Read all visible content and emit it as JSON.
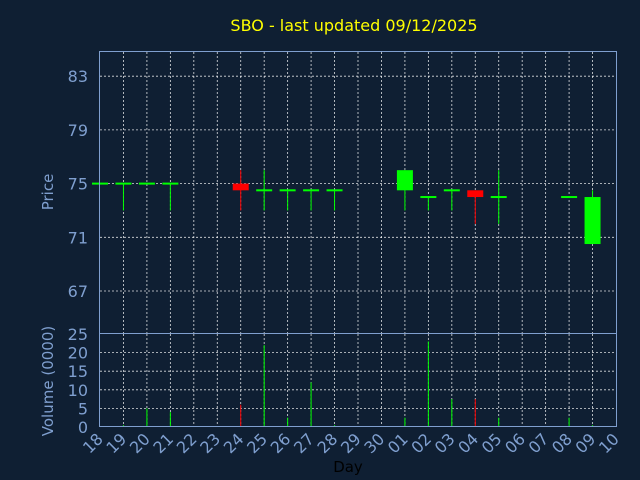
{
  "title": "SBO - last updated 09/12/2025",
  "colors": {
    "background": "#0f1f33",
    "up": "#00ff00",
    "down": "#ff0000",
    "text": "#7f9fcf",
    "title": "#ffff00"
  },
  "chart_data": {
    "type": "candlestick",
    "title": "SBO - last updated 09/12/2025",
    "xlabel": "Day",
    "price_panel": {
      "ylabel": "Price",
      "ylim": [
        63.8,
        84.8
      ],
      "yticks": [
        67,
        71,
        75,
        79,
        83
      ],
      "grid": true
    },
    "volume_panel": {
      "ylabel": "Volume (0000)",
      "ylim": [
        0,
        25
      ],
      "yticks": [
        0,
        5,
        10,
        15,
        20,
        25
      ],
      "grid": true
    },
    "x_ticks": [
      "18",
      "19",
      "20",
      "21",
      "22",
      "23",
      "24",
      "25",
      "26",
      "27",
      "28",
      "29",
      "30",
      "01",
      "02",
      "03",
      "04",
      "05",
      "06",
      "07",
      "08",
      "09",
      "10"
    ],
    "candles": [
      {
        "x": "18",
        "open": 75.0,
        "high": 75.0,
        "low": 75.0,
        "close": 75.0,
        "volume": 0.2
      },
      {
        "x": "19",
        "open": 75.0,
        "high": 75.0,
        "low": 73.0,
        "close": 75.0,
        "volume": 0.5
      },
      {
        "x": "20",
        "open": 75.0,
        "high": 75.0,
        "low": 75.0,
        "close": 75.0,
        "volume": 5
      },
      {
        "x": "21",
        "open": 75.0,
        "high": 75.0,
        "low": 73.0,
        "close": 75.0,
        "volume": 4
      },
      {
        "x": "24",
        "open": 75.0,
        "high": 76.0,
        "low": 73.0,
        "close": 74.5,
        "volume": 6
      },
      {
        "x": "25",
        "open": 74.5,
        "high": 76.0,
        "low": 73.0,
        "close": 74.5,
        "volume": 22
      },
      {
        "x": "26",
        "open": 74.5,
        "high": 74.5,
        "low": 73.0,
        "close": 74.5,
        "volume": 2.5
      },
      {
        "x": "27",
        "open": 74.5,
        "high": 74.5,
        "low": 73.0,
        "close": 74.5,
        "volume": 12
      },
      {
        "x": "28",
        "open": 74.5,
        "high": 74.5,
        "low": 73.0,
        "close": 74.5,
        "volume": 0.5
      },
      {
        "x": "01",
        "open": 74.5,
        "high": 76.0,
        "low": 73.0,
        "close": 76.0,
        "volume": 2.5
      },
      {
        "x": "02",
        "open": 74.0,
        "high": 74.0,
        "low": 73.0,
        "close": 74.0,
        "volume": 23
      },
      {
        "x": "03",
        "open": 74.5,
        "high": 74.5,
        "low": 73.0,
        "close": 74.5,
        "volume": 7.5
      },
      {
        "x": "04",
        "open": 74.5,
        "high": 74.5,
        "low": 72.0,
        "close": 74.0,
        "volume": 7.5
      },
      {
        "x": "05",
        "open": 74.0,
        "high": 76.0,
        "low": 72.0,
        "close": 74.0,
        "volume": 2.5
      },
      {
        "x": "08",
        "open": 74.0,
        "high": 74.0,
        "low": 74.0,
        "close": 74.0,
        "volume": 2.5
      },
      {
        "x": "09",
        "open": 70.5,
        "high": 74.5,
        "low": 70.5,
        "close": 74.0,
        "volume": 0.5
      }
    ]
  }
}
